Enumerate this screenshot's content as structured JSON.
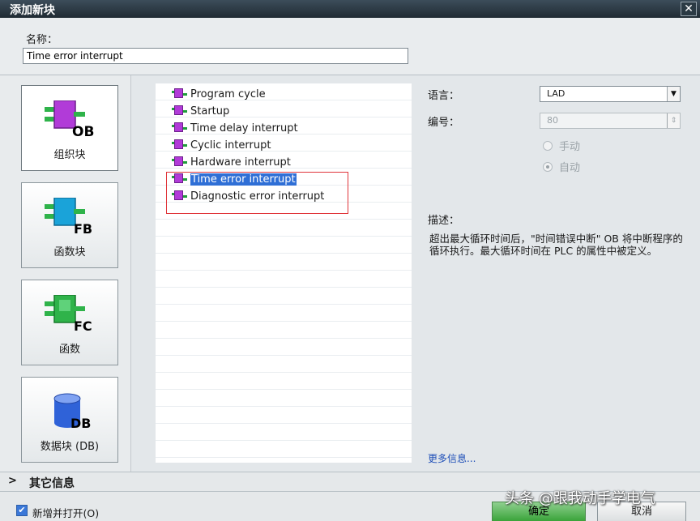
{
  "window": {
    "title": "添加新块",
    "close_glyph": "✕"
  },
  "name": {
    "label": "名称：",
    "value": "Time error interrupt"
  },
  "categories": [
    {
      "label": "组织块",
      "badge": "OB",
      "active": true,
      "color": "#b13bd8"
    },
    {
      "label": "函数块",
      "badge": "FB",
      "active": false,
      "color": "#1aa3d9"
    },
    {
      "label": "函数",
      "badge": "FC",
      "active": false,
      "color": "#2fb34a"
    },
    {
      "label": "数据块 (DB)",
      "badge": "DB",
      "active": false,
      "color": "#2f62d8"
    }
  ],
  "block_list": [
    "Program cycle",
    "Startup",
    "Time delay interrupt",
    "Cyclic interrupt",
    "Hardware interrupt",
    "Time error interrupt",
    "Diagnostic error interrupt"
  ],
  "selected_index": 5,
  "language": {
    "label": "语言：",
    "value": "LAD"
  },
  "number": {
    "label": "编号：",
    "value": "80"
  },
  "mode": {
    "manual": "手动",
    "auto": "自动",
    "selected": "auto"
  },
  "description": {
    "label": "描述：",
    "text": "超出最大循环时间后，\"时间错误中断\" OB 将中断程序的循环执行。最大循环时间在 PLC 的属性中被定义。"
  },
  "more_info": "更多信息...",
  "other_info": {
    "chevron": ">",
    "label": "其它信息"
  },
  "add_and_open": {
    "label": "新增并打开(O)",
    "checked": true
  },
  "buttons": {
    "ok": "确定",
    "cancel": "取消"
  },
  "watermark": "头条 @跟我动手学电气"
}
